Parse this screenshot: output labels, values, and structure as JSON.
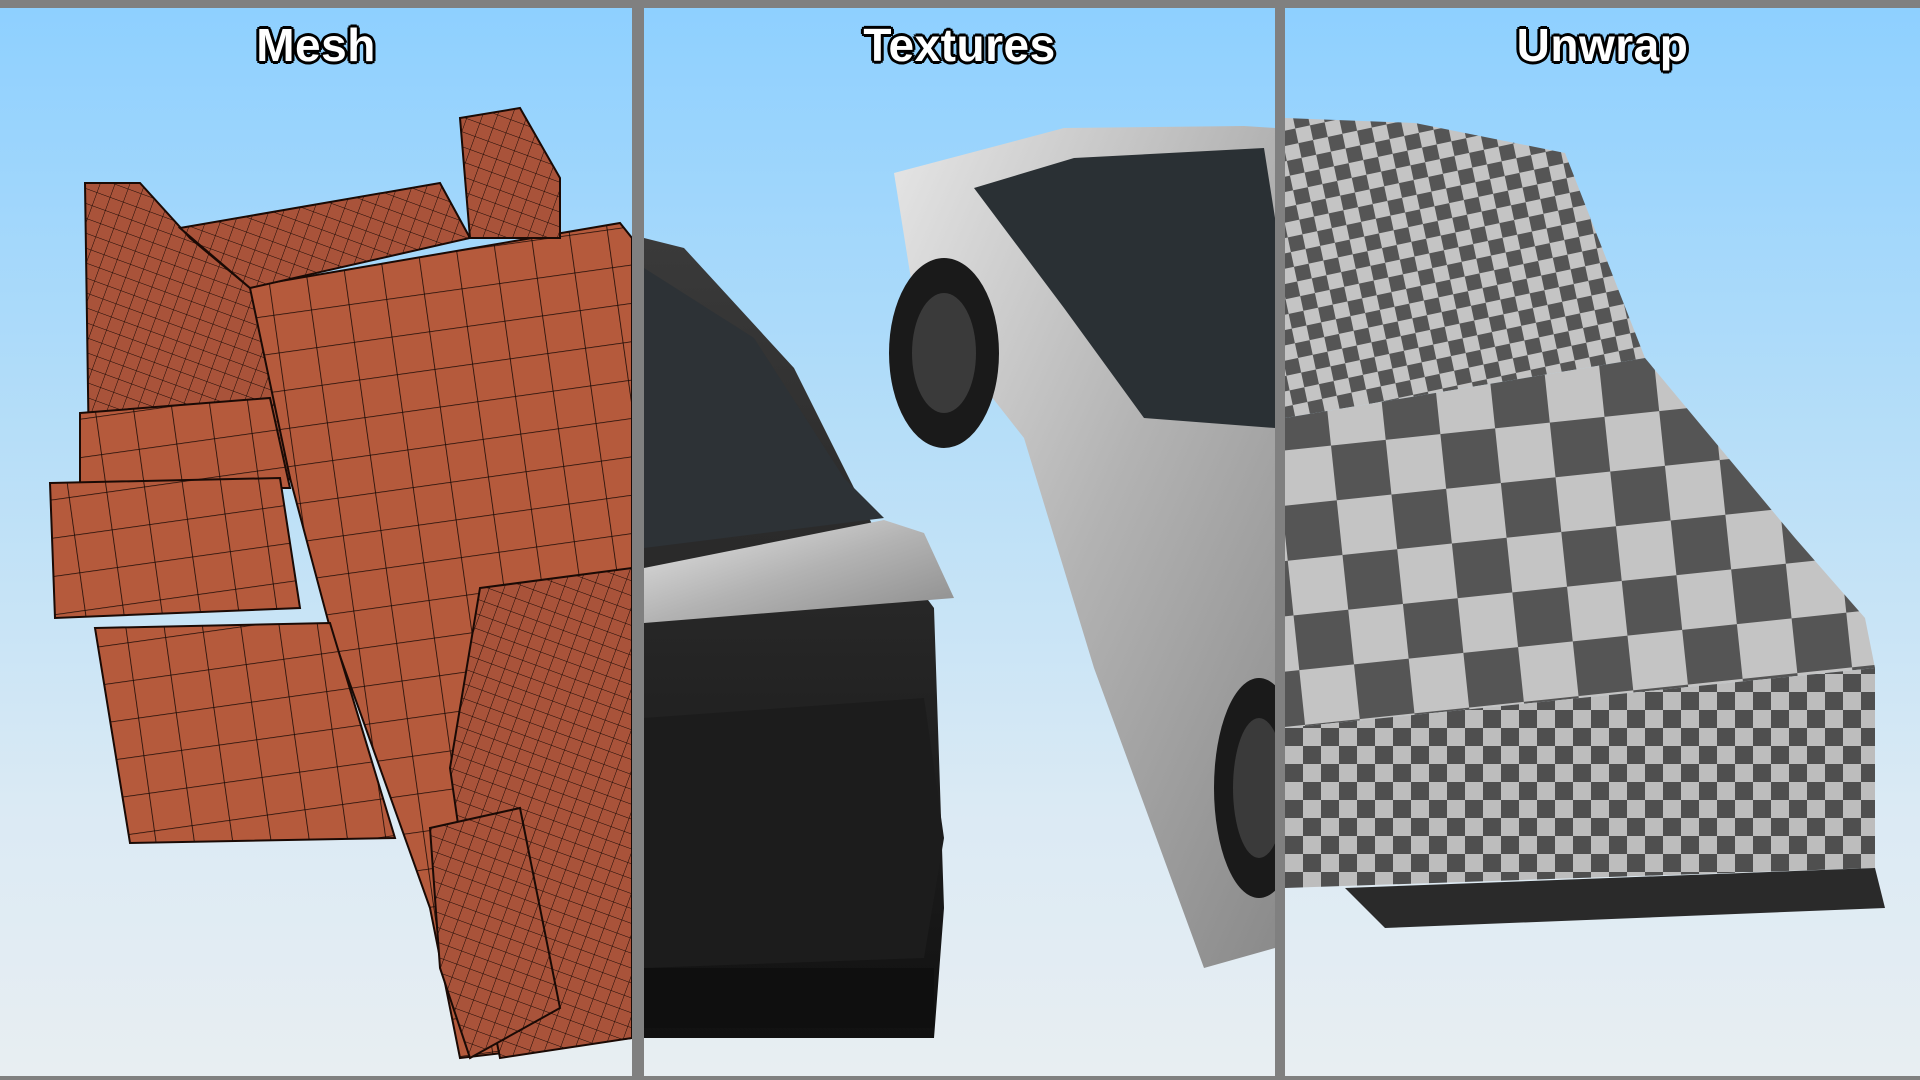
{
  "panels": [
    {
      "title": "Mesh",
      "view": "wireframe-render"
    },
    {
      "title": "Textures",
      "view": "textured-render"
    },
    {
      "title": "Unwrap",
      "view": "uv-checker-render"
    }
  ],
  "colors": {
    "divider": "#808080",
    "sky_top": "#8ed0ff",
    "sky_bottom": "#e8eef2",
    "mesh_fill": "#b55a3c",
    "mesh_wire": "#1a0a05",
    "checker_dark": "#555555",
    "checker_light": "#c4c4c4"
  }
}
